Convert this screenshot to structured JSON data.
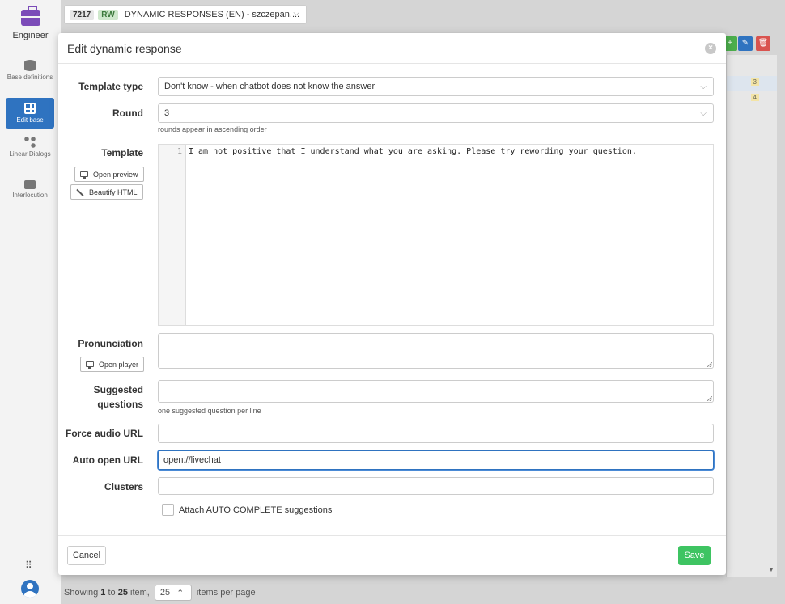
{
  "sidebar": {
    "logo_label": "Engineer",
    "items": [
      {
        "label": "Base definitions",
        "icon": "database-icon"
      },
      {
        "label": "Edit base",
        "icon": "table-icon"
      },
      {
        "label": "Linear Dialogs",
        "icon": "flow-icon"
      },
      {
        "label": "Interlocution",
        "icon": "chat-icon"
      }
    ]
  },
  "topbar": {
    "base_id": "7217",
    "base_mode": "RW",
    "base_name": "DYNAMIC RESPONSES (EN) - szczepan...."
  },
  "background": {
    "row_numbers": [
      "3",
      "4"
    ]
  },
  "footer": {
    "showing_prefix": "Showing",
    "from": "1",
    "to_word": "to",
    "to": "25",
    "item_suffix": "item,",
    "per_page": "25",
    "per_page_label": "items per page"
  },
  "modal": {
    "title": "Edit dynamic response",
    "fields": {
      "template_type_label": "Template type",
      "template_type_value": "Don't know - when chatbot does not know the answer",
      "round_label": "Round",
      "round_value": "3",
      "round_hint": "rounds appear in ascending order",
      "template_label": "Template",
      "open_preview": "Open preview",
      "beautify_html": "Beautify HTML",
      "template_line_number": "1",
      "template_code": "I am not positive that I understand what you are asking. Please try rewording your question.",
      "pronunciation_label": "Pronunciation",
      "open_player": "Open player",
      "suggested_label_1": "Suggested",
      "suggested_label_2": "questions",
      "suggested_hint": "one suggested question per line",
      "force_audio_label": "Force audio URL",
      "force_audio_value": "",
      "auto_open_label": "Auto open URL",
      "auto_open_value": "open://livechat",
      "clusters_label": "Clusters",
      "clusters_value": "",
      "autocomplete_label": "Attach AUTO COMPLETE suggestions"
    },
    "cancel": "Cancel",
    "save": "Save"
  },
  "colors": {
    "accent": "#2f73c0",
    "save": "#3ec462",
    "brand": "#7b4bb8"
  }
}
